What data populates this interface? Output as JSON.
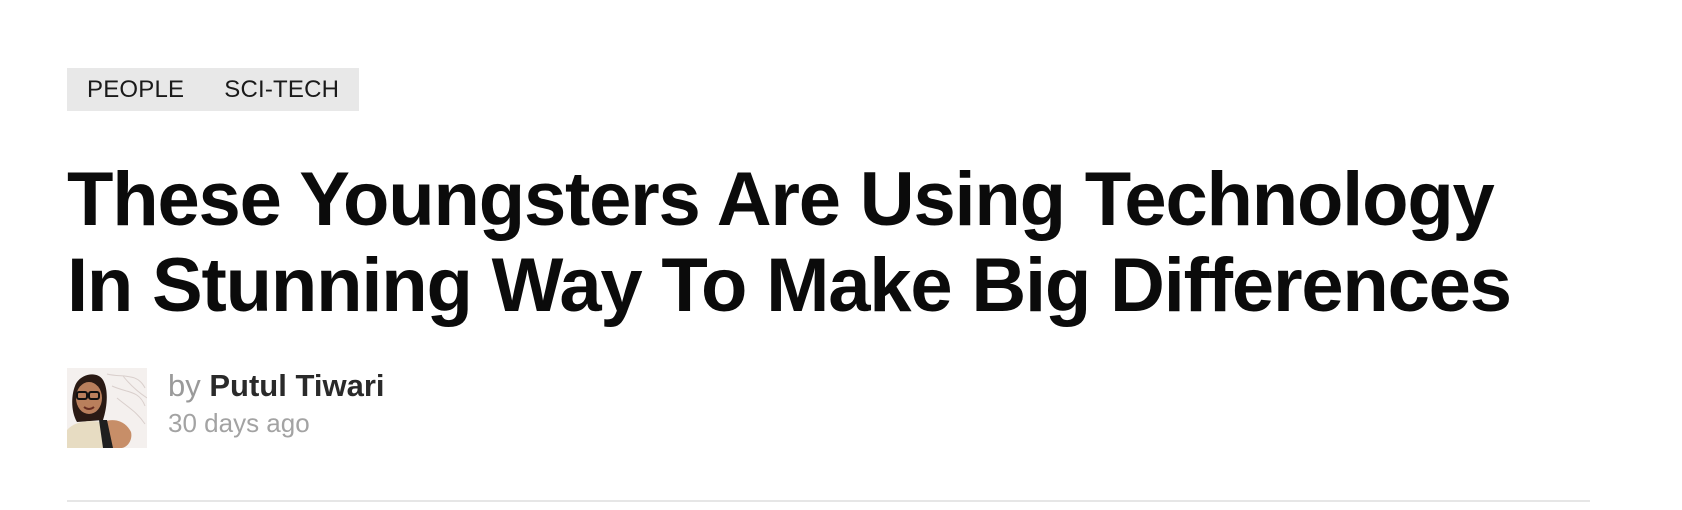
{
  "article": {
    "categories": [
      {
        "label": "PEOPLE"
      },
      {
        "label": "SCI-TECH"
      }
    ],
    "headline_lines": [
      "These Youngsters Are Using Technology",
      "In Stunning Way To Make Big Differences"
    ],
    "byline": {
      "by_prefix": "by",
      "author_name": "Putul Tiwari",
      "timestamp": "30 days ago"
    }
  }
}
